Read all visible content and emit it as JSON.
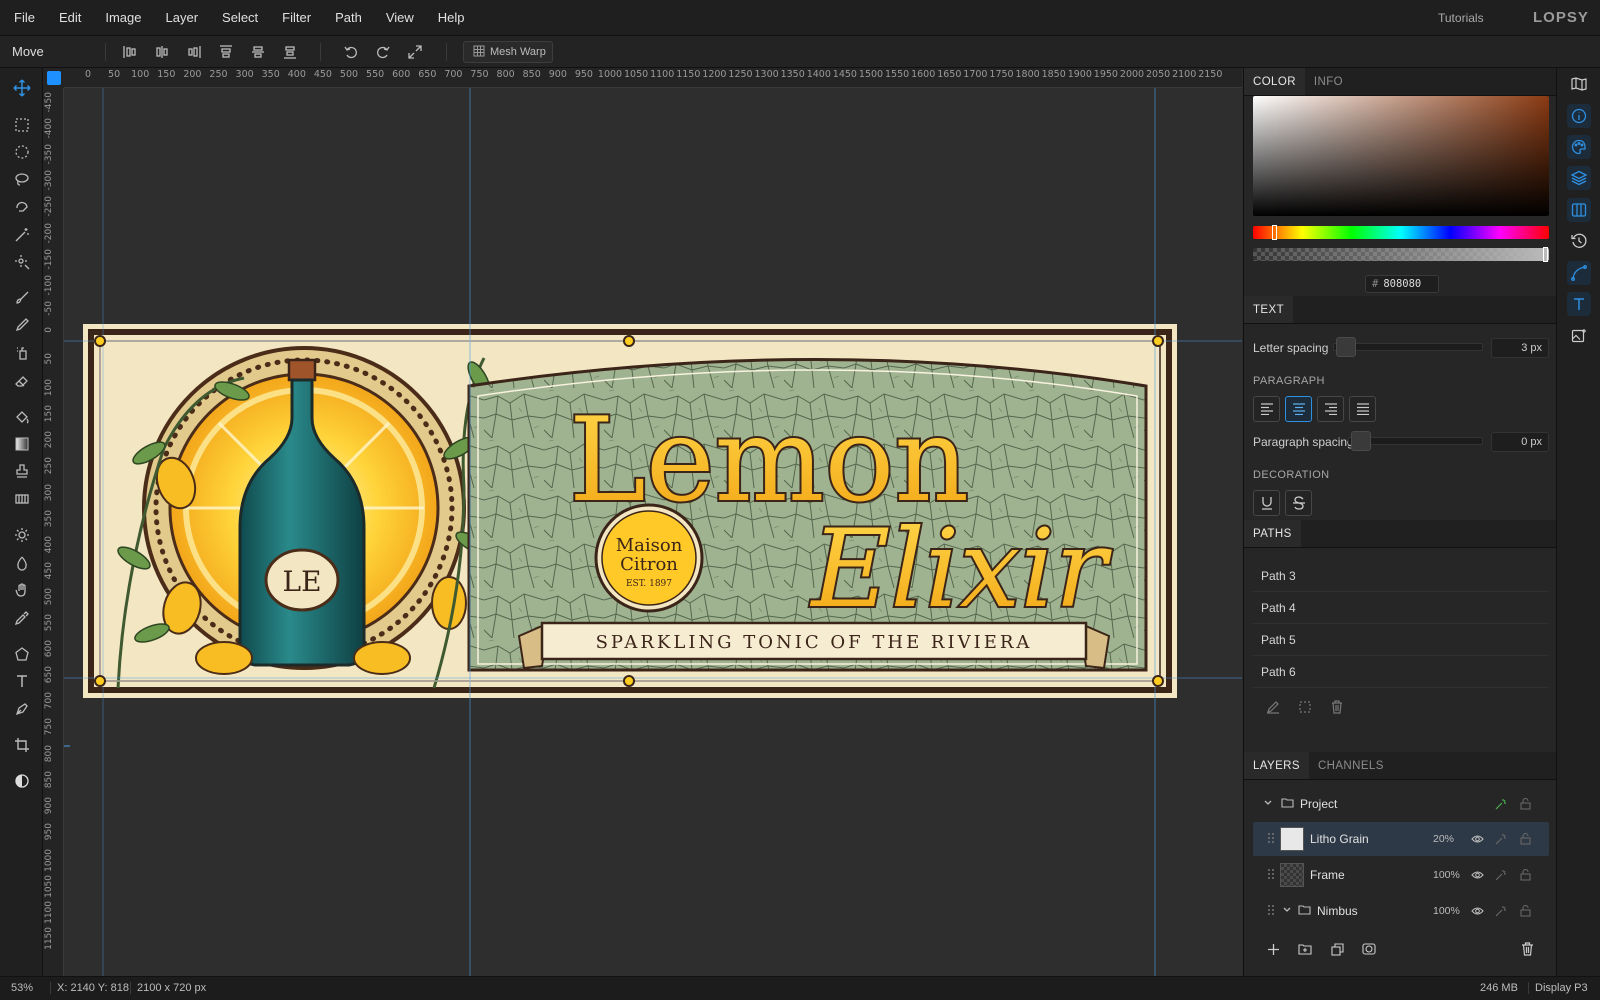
{
  "menubar": {
    "items": [
      "File",
      "Edit",
      "Image",
      "Layer",
      "Select",
      "Filter",
      "Path",
      "View",
      "Help"
    ],
    "tutorials": "Tutorials",
    "logo": "LOPSY"
  },
  "toolbar": {
    "tool_name": "Move",
    "mesh_warp": "Mesh Warp",
    "icons": [
      "align-left-icon",
      "align-center-h-icon",
      "align-right-icon",
      "align-top-icon",
      "align-middle-v-icon",
      "align-bottom-icon",
      "undo-icon",
      "redo-icon",
      "fit-screen-icon",
      "grid-icon"
    ]
  },
  "rulers": {
    "top": [
      "0",
      "50",
      "100",
      "150",
      "200",
      "250",
      "300",
      "350",
      "400",
      "450",
      "500",
      "550",
      "600",
      "650",
      "700",
      "750",
      "800",
      "850",
      "900",
      "950",
      "1000",
      "1050",
      "1100",
      "1150",
      "1200",
      "1250",
      "1300",
      "1350",
      "1400",
      "1450",
      "1500",
      "1550",
      "1600",
      "1650",
      "1700",
      "1750",
      "1800",
      "1850",
      "1900",
      "1950",
      "2000",
      "2050",
      "2100",
      "2150"
    ],
    "left": [
      "-450",
      "-400",
      "-350",
      "-300",
      "-250",
      "-200",
      "-150",
      "-100",
      "-50",
      "0",
      "50",
      "100",
      "150",
      "200",
      "250",
      "300",
      "350",
      "400",
      "450",
      "500",
      "550",
      "600",
      "650",
      "700",
      "750",
      "800",
      "850",
      "900",
      "950",
      "1000",
      "1050",
      "1100",
      "1150"
    ]
  },
  "artwork": {
    "title_line1": "Lemon",
    "title_line2": "Elixir",
    "tagline": "SPARKLING TONIC OF THE RIVIERA",
    "seal_line1": "Maison",
    "seal_line2": "Citron",
    "seal_line3": "EST. 1897",
    "bottle_monogram": "LE"
  },
  "panel": {
    "color_tabs": [
      "COLOR",
      "INFO"
    ],
    "hex_prefix": "#",
    "hex": "808080",
    "text_tab": "TEXT",
    "letter_spacing_label": "Letter spacing",
    "letter_spacing_value": "3 px",
    "paragraph_head": "PARAGRAPH",
    "paragraph_spacing_label": "Paragraph spacing",
    "paragraph_spacing_value": "0 px",
    "decoration_head": "DECORATION",
    "paths_tab": "PATHS",
    "paths": [
      "Path 3",
      "Path 4",
      "Path 5",
      "Path 6"
    ],
    "layer_tabs": [
      "LAYERS",
      "CHANNELS"
    ],
    "layers": [
      {
        "name": "Project",
        "opacity": ""
      },
      {
        "name": "Litho Grain",
        "opacity": "20%"
      },
      {
        "name": "Frame",
        "opacity": "100%"
      },
      {
        "name": "Nimbus",
        "opacity": "100%"
      }
    ]
  },
  "status": {
    "zoom": "53%",
    "coords": "X: 2140 Y: 818",
    "doc_size": "2100 x 720 px",
    "memory": "246 MB",
    "profile": "Display P3"
  },
  "colors": {
    "accent": "#2f8fe0",
    "label_cream": "#f3e6c2",
    "lemon_yellow": "#f5b51a",
    "frame_brown": "#3b2418",
    "mosaic_green": "#9aae8c",
    "bottle_teal": "#1f6b6e"
  }
}
